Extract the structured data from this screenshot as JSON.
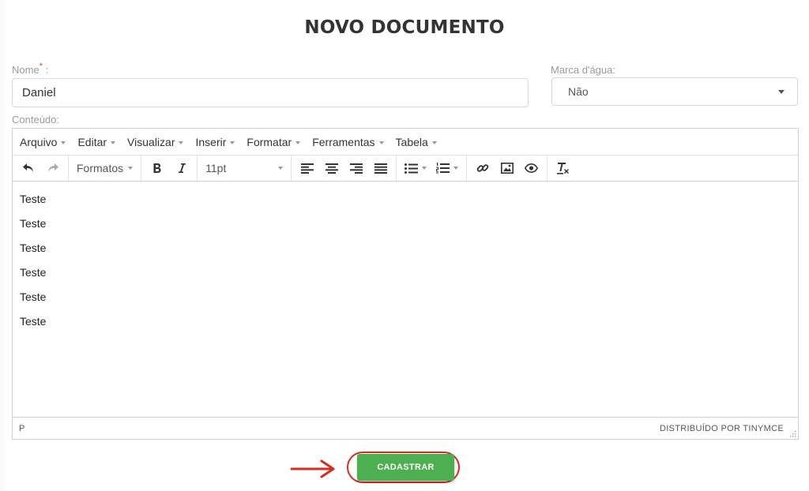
{
  "page": {
    "title": "NOVO DOCUMENTO"
  },
  "form": {
    "name_label": "Nome",
    "name_required_mark": "*",
    "name_label_suffix": " :",
    "name_value": "Daniel",
    "watermark_label": "Marca d'água:",
    "watermark_selected": "Não",
    "content_label": "Conteúdo:"
  },
  "editor": {
    "menus": [
      "Arquivo",
      "Editar",
      "Visualizar",
      "Inserir",
      "Formatar",
      "Ferramentas",
      "Tabela"
    ],
    "formats_label": "Formatos",
    "font_size": "11pt",
    "content_lines": [
      "Teste",
      "Teste",
      "Teste",
      "Teste",
      "Teste",
      "Teste"
    ],
    "status_path": "P",
    "powered_by": "DISTRIBUÍDO POR  TINYMCE"
  },
  "actions": {
    "submit_label": "CADASTRAR"
  },
  "colors": {
    "submit_bg": "#4caf50",
    "highlight": "#d92a20"
  }
}
